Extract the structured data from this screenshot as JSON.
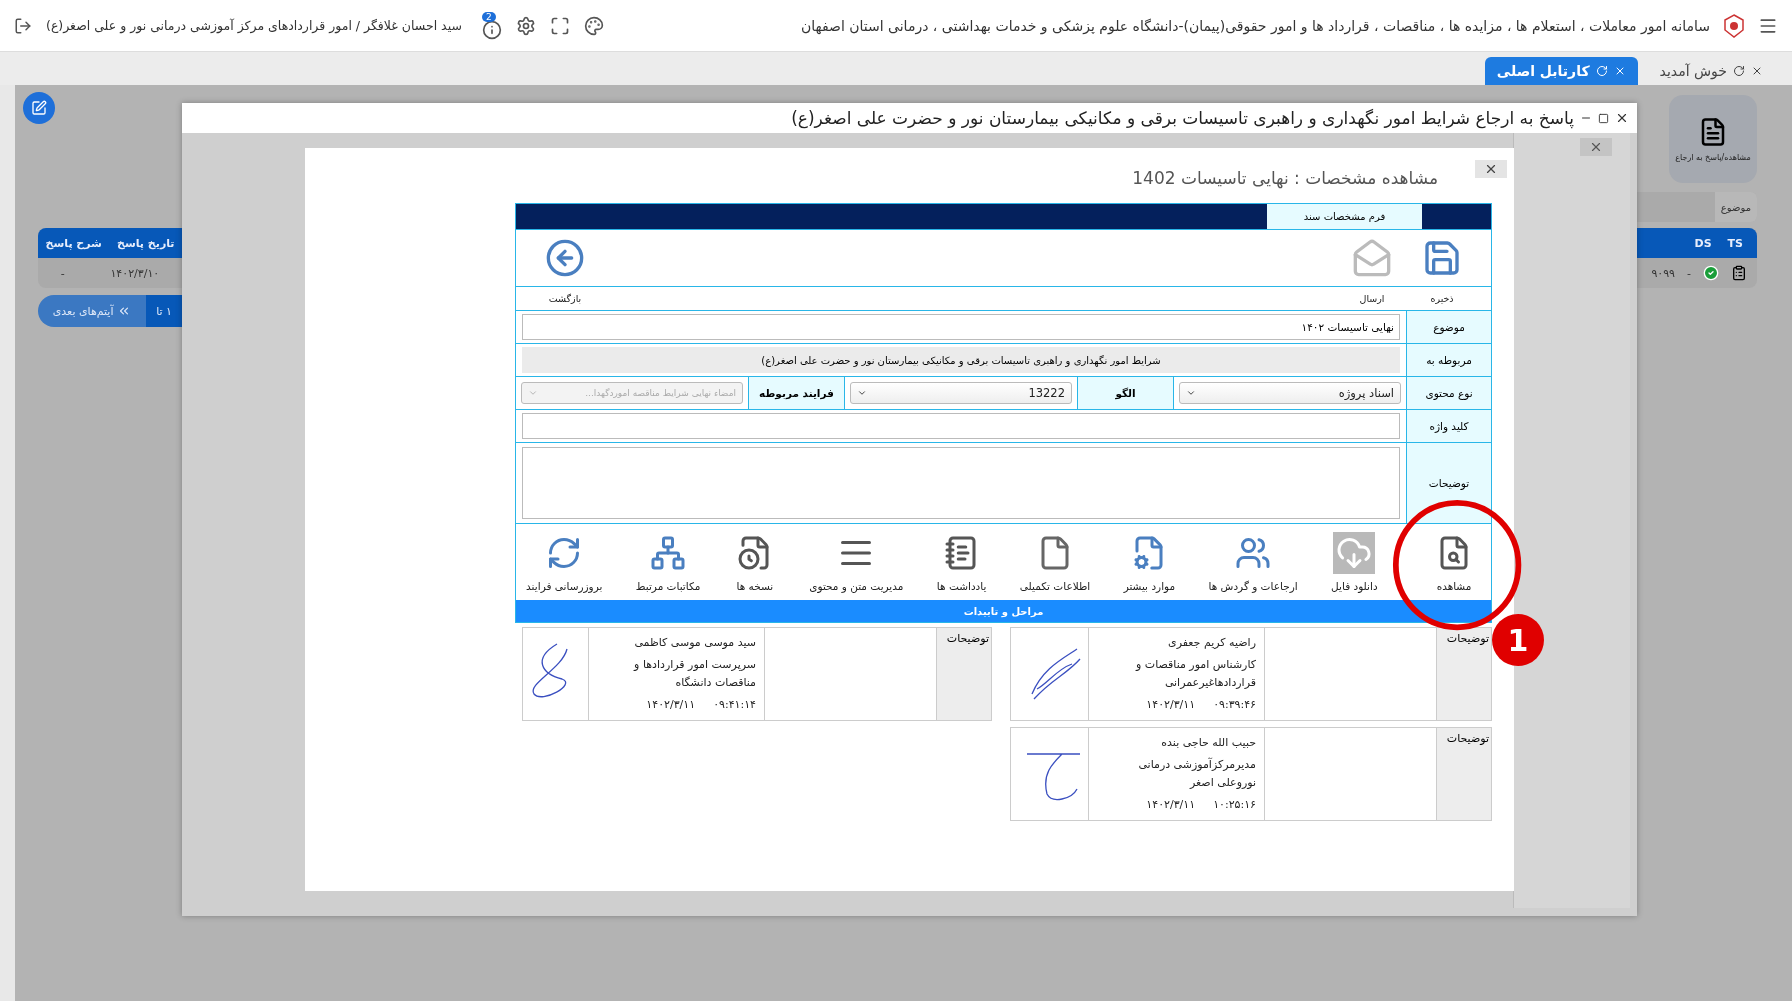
{
  "top_bar": {
    "title": "سامانه امور معاملات ، استعلام ها ، مزایده ها ، مناقصات ، قرارداد ها و امور حقوقی(پیمان)-دانشگاه علوم پزشکی و خدمات بهداشتی ، درمانی استان اصفهان",
    "info_badge": "2",
    "user": "سید احسان غلافگر / امور قراردادهای مرکز آموزشی درمانی نور و علی اصغر(ع)"
  },
  "tabs": [
    {
      "label": "خوش آمدید",
      "selected": false
    },
    {
      "label": "کارتابل اصلی",
      "selected": true
    }
  ],
  "background": {
    "card_label": "مشاهده/پاسخ به ارجاع",
    "subject_label": "موضوع",
    "table_columns": [
      "TS",
      "DS"
    ],
    "table_row": [
      "-",
      "۹۰۹۹"
    ],
    "left_columns": [
      "تاریخ پاسخ",
      "شرح پاسخ"
    ],
    "left_row": [
      "۱۴۰۲/۳/۱۰",
      "-"
    ],
    "pager_range": "۱ تا",
    "pager_next": "آیتم‌های بعدی"
  },
  "window": {
    "title": "پاسخ به ارجاع شرایط امور نگهداری و راهبری تاسیسات برقی و مکانیکی بیمارستان نور و حضرت علی اصغر(ع)"
  },
  "dialog": {
    "title": "مشاهده مشخصات : نهایی تاسیسات 1402",
    "form_tab": "فرم مشخصات سند",
    "toolbar": [
      {
        "kind": "save",
        "label": "ذخیره",
        "disabled": false
      },
      {
        "kind": "send",
        "label": "ارسال",
        "disabled": true
      },
      {
        "kind": "back",
        "label": "بازگشت",
        "disabled": false
      }
    ],
    "fields": [
      {
        "kind": "input",
        "label": "موضوع",
        "value": "نهایی تاسیسات ۱۴۰۲"
      },
      {
        "kind": "readonly",
        "label": "مربوطه به",
        "value": "شرایط امور نگهداری و راهبری تاسیسات برقی و مکانیکی بیمارستان نور و حضرت علی اصغر(ع)"
      },
      {
        "kind": "selects",
        "label": "نوع محتوی",
        "items": [
          {
            "kind": "select",
            "value": "اسناد پروژه",
            "disabled": false
          },
          {
            "kind": "label",
            "text": "الگو"
          },
          {
            "kind": "select",
            "value": "13222",
            "disabled": false
          },
          {
            "kind": "label",
            "text": "فرایند مربوطه"
          },
          {
            "kind": "select",
            "value": "امضاء نهایی شرایط مناقصه اموردگهدا...",
            "disabled": true
          }
        ]
      },
      {
        "kind": "input",
        "label": "کلید واژه"
      },
      {
        "kind": "textarea",
        "label": "توضیحات"
      }
    ],
    "actions": [
      {
        "kind": "view",
        "label": "مشاهده",
        "highlighted": false
      },
      {
        "kind": "download",
        "label": "دانلود فایل",
        "highlighted": true
      },
      {
        "kind": "referrals",
        "label": "ارجاعات و گردش ها",
        "highlighted": false
      },
      {
        "kind": "more",
        "label": "موارد بیشتر",
        "highlighted": false
      },
      {
        "kind": "info",
        "label": "اطلاعات تکمیلی",
        "highlighted": false
      },
      {
        "kind": "notes",
        "label": "یادداشت ها",
        "highlighted": false
      },
      {
        "kind": "text",
        "label": "مدیریت متن و محتوی",
        "highlighted": false
      },
      {
        "kind": "versions",
        "label": "نسخه ها",
        "highlighted": false
      },
      {
        "kind": "letters",
        "label": "مکاتبات مرتبط",
        "highlighted": false
      },
      {
        "kind": "refresh",
        "label": "بروزرسانی فرایند",
        "highlighted": false
      }
    ],
    "section_title": "مراحل و تاییدات",
    "approvals": [
      {
        "comment_label": "توضیحات",
        "name": "راضیه کریم جعفری",
        "role": "کارشناس امور مناقصات و قراردادهاغیرعمرانی",
        "date": "۱۴۰۲/۳/۱۱",
        "time": "۰۹:۳۹:۴۶"
      },
      {
        "comment_label": "توضیحات",
        "name": "سید موسی موسی کاظمی",
        "role": "سرپرست امور قراردادها و مناقصات دانشگاه",
        "date": "۱۴۰۲/۳/۱۱",
        "time": "۰۹:۴۱:۱۴"
      },
      {
        "comment_label": "توضیحات",
        "name": "حبیب الله حاجی بنده",
        "role": "مدیرمرکزآموزشی درمانی نوروعلی اصغر",
        "date": "۱۴۰۲/۳/۱۱",
        "time": "۱۰:۲۵:۱۶"
      }
    ]
  },
  "annotation": {
    "number": "1"
  }
}
